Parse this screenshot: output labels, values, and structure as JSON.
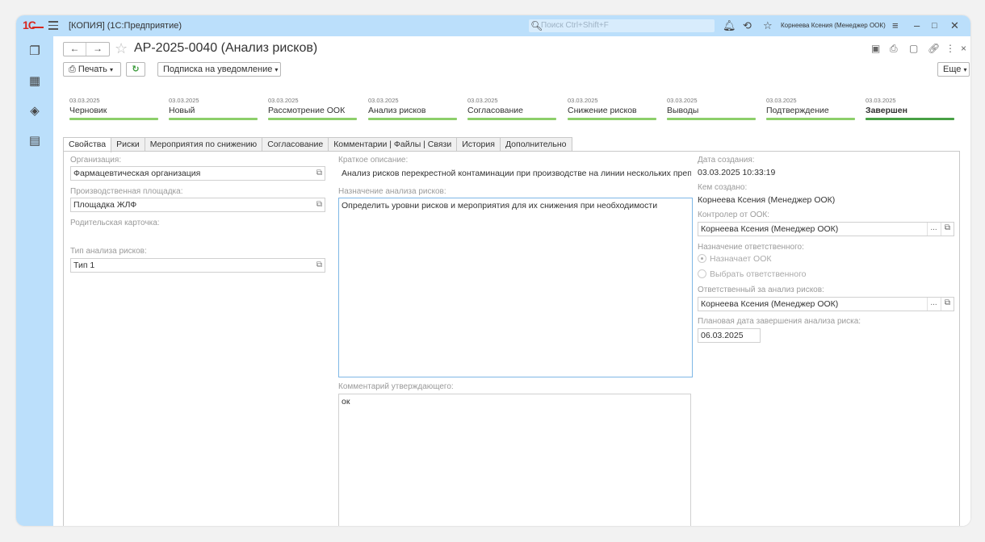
{
  "window": {
    "title": "[КОПИЯ]  (1С:Предприятие)",
    "logo": "1С",
    "search_placeholder": "Поиск Ctrl+Shift+F",
    "user": "Корнеева Ксения (Менеджер ООК)"
  },
  "toolbar": {
    "doc_title": "АР-2025-0040 (Анализ рисков)",
    "print_label": "Печать",
    "subscribe_label": "Подписка на уведомление",
    "more_label": "Еще"
  },
  "statuses": [
    {
      "date": "03.03.2025",
      "label": "Черновик"
    },
    {
      "date": "03.03.2025",
      "label": "Новый"
    },
    {
      "date": "03.03.2025",
      "label": "Рассмотрение ООК"
    },
    {
      "date": "03.03.2025",
      "label": "Анализ рисков"
    },
    {
      "date": "03.03.2025",
      "label": "Согласование"
    },
    {
      "date": "03.03.2025",
      "label": "Снижение рисков"
    },
    {
      "date": "03.03.2025",
      "label": "Выводы"
    },
    {
      "date": "03.03.2025",
      "label": "Подтверждение"
    },
    {
      "date": "03.03.2025",
      "label": "Завершен"
    }
  ],
  "tabs": [
    "Свойства",
    "Риски",
    "Мероприятия по снижению",
    "Согласование",
    "Комментарии | Файлы | Связи",
    "История",
    "Дополнительно"
  ],
  "form": {
    "org_label": "Организация:",
    "org_value": "Фармацевтическая организация",
    "site_label": "Производственная площадка:",
    "site_value": "Площадка ЖЛФ",
    "parent_label": "Родительская карточка:",
    "type_label": "Тип анализа рисков:",
    "type_value": "Тип 1",
    "short_label": "Краткое описание:",
    "short_value": "Анализ рисков перекрестной контаминации при производстве на линии нескольких препар",
    "purpose_label": "Назначение анализа рисков:",
    "purpose_value": "Определить уровни рисков и мероприятия для их снижения при необходимости",
    "comment_label": "Комментарий утверждающего:",
    "comment_value": "ок",
    "created_label": "Дата создания:",
    "created_value": "03.03.2025 10:33:19",
    "author_label": "Кем создано:",
    "author_value": "Корнеева Ксения (Менеджер ООК)",
    "controller_label": "Контролер от ООК:",
    "controller_value": "Корнеева Ксения (Менеджер ООК)",
    "assign_label": "Назначение ответственного:",
    "radio_ook": "Назначает ООК",
    "radio_choose": "Выбрать ответственного",
    "responsible_label": "Ответственный за анализ рисков:",
    "responsible_value": "Корнеева Ксения (Менеджер ООК)",
    "plan_label": "Плановая дата завершения анализа риска:",
    "plan_value": "06.03.2025"
  },
  "icons": {
    "more": "...",
    "open": "⧉"
  }
}
